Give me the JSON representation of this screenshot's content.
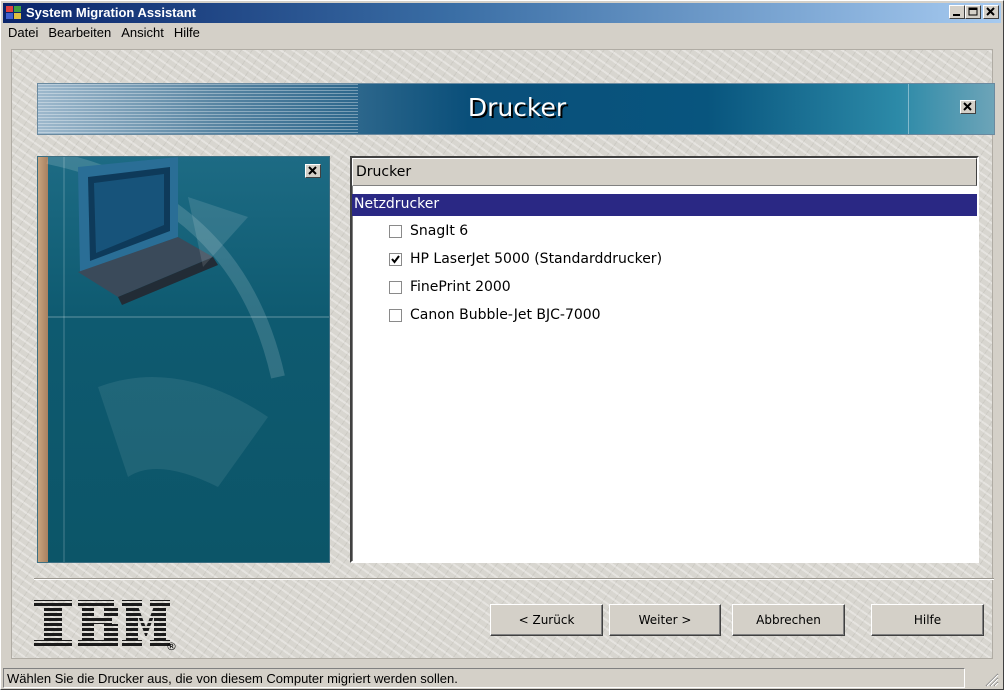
{
  "window": {
    "title": "System Migration Assistant"
  },
  "menu": {
    "items": [
      "Datei",
      "Bearbeiten",
      "Ansicht",
      "Hilfe"
    ]
  },
  "banner": {
    "title": "Drucker"
  },
  "list": {
    "header": "Drucker",
    "group": "Netzdrucker",
    "printers": [
      {
        "label": "SnagIt 6",
        "checked": false
      },
      {
        "label": "HP LaserJet 5000 (Standarddrucker)",
        "checked": true
      },
      {
        "label": "FinePrint 2000",
        "checked": false
      },
      {
        "label": "Canon Bubble-Jet BJC-7000",
        "checked": false
      }
    ]
  },
  "buttons": {
    "back": "< Zurück",
    "next": "Weiter >",
    "cancel": "Abbrechen",
    "help": "Hilfe"
  },
  "logo": {
    "text": "IBM",
    "registered": "®"
  },
  "status": {
    "text": "Wählen Sie die Drucker aus, die von diesem Computer migriert werden sollen."
  },
  "colors": {
    "titlebar": "#0a246a",
    "selection": "#2a2884",
    "banner": "#0a4f7a",
    "panel": "#0e5a70"
  },
  "icons": [
    "app-icon",
    "minimize-icon",
    "maximize-icon",
    "close-icon",
    "checkmark-icon",
    "size-grip-icon"
  ]
}
